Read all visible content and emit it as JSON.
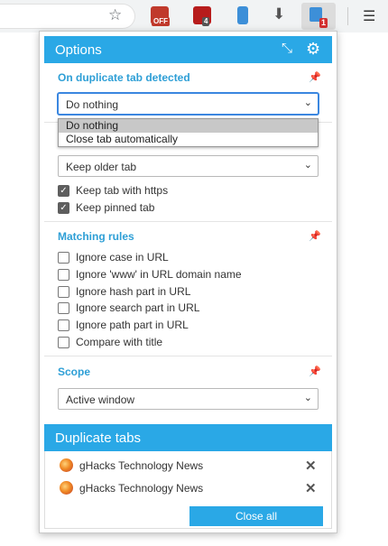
{
  "toolbar": {
    "extensions": [
      {
        "name": "adblock-extension",
        "badge": "OFF",
        "color": "#c0392b",
        "badge_color": "#c0392b"
      },
      {
        "name": "ublock-extension",
        "badge": "4",
        "color": "#b71c1c",
        "badge_color": "#555555"
      },
      {
        "name": "bookmark-extension",
        "badge": "",
        "color": "#3d8fd8",
        "badge_color": ""
      },
      {
        "name": "download-extension",
        "badge": "",
        "color": "#555555",
        "badge_color": ""
      },
      {
        "name": "duplicate-tabs-extension",
        "badge": "1",
        "color": "#3d8fd8",
        "badge_color": "#d32f2f"
      }
    ]
  },
  "popup": {
    "title": "Options",
    "on_duplicate": {
      "title": "On duplicate tab detected",
      "action_value": "Do nothing",
      "action_options": [
        "Do nothing",
        "Close tab automatically"
      ],
      "keep_value": "Keep older tab",
      "keep_https_label": "Keep tab with https",
      "keep_pinned_label": "Keep pinned tab"
    },
    "matching_rules": {
      "title": "Matching rules",
      "items": [
        {
          "label": "Ignore case in URL"
        },
        {
          "label": "Ignore 'www' in URL domain name"
        },
        {
          "label": "Ignore hash part in URL"
        },
        {
          "label": "Ignore search part in URL"
        },
        {
          "label": "Ignore path part in URL"
        },
        {
          "label": "Compare with title"
        }
      ]
    },
    "scope": {
      "title": "Scope",
      "value": "Active window"
    },
    "duplicate_tabs": {
      "title": "Duplicate tabs",
      "tabs": [
        {
          "title": "gHacks Technology News"
        },
        {
          "title": "gHacks Technology News"
        }
      ],
      "close_all_label": "Close all"
    }
  },
  "colors": {
    "accent": "#2aa8e6",
    "section_title": "#2e9fd6",
    "pin": "#f0a030"
  }
}
